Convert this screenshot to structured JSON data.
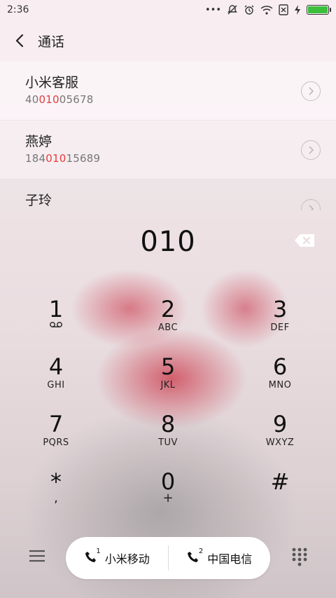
{
  "status": {
    "time": "2:36",
    "more": "•••"
  },
  "header": {
    "title": "通话"
  },
  "contacts": [
    {
      "name": "小米客服",
      "number_pre": "40",
      "number_hl": "010",
      "number_post": "05678"
    },
    {
      "name": "燕婷",
      "number_pre": "184",
      "number_hl": "010",
      "number_post": "15689"
    },
    {
      "name": "子玲",
      "number_pre": "",
      "number_hl": "",
      "number_post": ""
    }
  ],
  "dialer": {
    "digits": "010"
  },
  "keys": [
    {
      "num": "1",
      "letters": ""
    },
    {
      "num": "2",
      "letters": "ABC"
    },
    {
      "num": "3",
      "letters": "DEF"
    },
    {
      "num": "4",
      "letters": "GHI"
    },
    {
      "num": "5",
      "letters": "JKL"
    },
    {
      "num": "6",
      "letters": "MNO"
    },
    {
      "num": "7",
      "letters": "PQRS"
    },
    {
      "num": "8",
      "letters": "TUV"
    },
    {
      "num": "9",
      "letters": "WXYZ"
    },
    {
      "num": "*",
      "letters": ","
    },
    {
      "num": "0",
      "letters": "+"
    },
    {
      "num": "#",
      "letters": ""
    }
  ],
  "sim": [
    {
      "slot": "1",
      "label": "小米移动"
    },
    {
      "slot": "2",
      "label": "中国电信"
    }
  ],
  "icons": {
    "back": "back-arrow-icon",
    "backspace": "backspace-icon",
    "menu": "menu-icon",
    "dialpad": "dialpad-icon",
    "voicemail": "voicemail-icon"
  },
  "colors": {
    "highlight": "#e33d3d",
    "battery": "#3cbf3c"
  }
}
